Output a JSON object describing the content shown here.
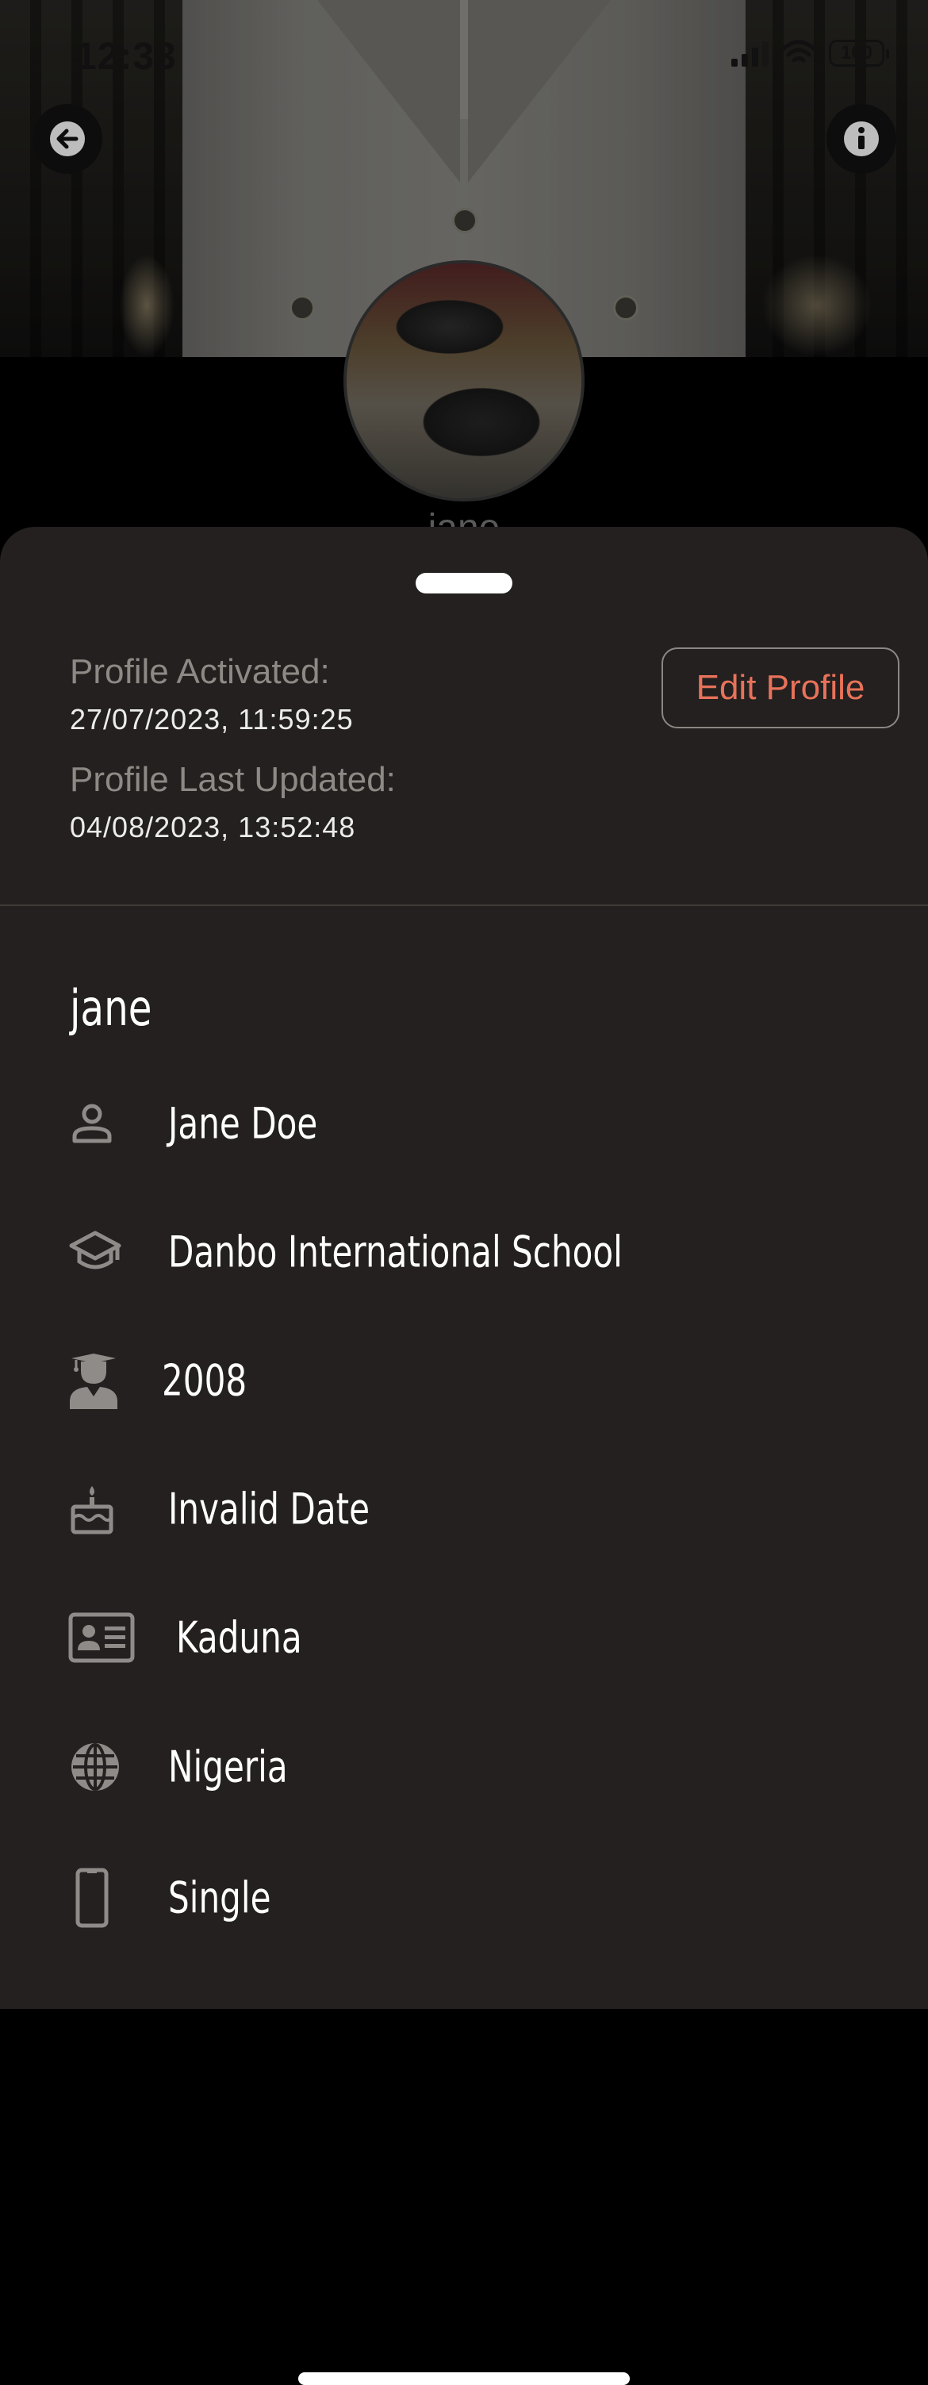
{
  "status_bar": {
    "time": "12:33",
    "battery": "100"
  },
  "header": {
    "back_icon": "arrow-left-icon",
    "info_icon": "info-icon",
    "under_avatar_name": "jane"
  },
  "sheet": {
    "profile_activated_label": "Profile Activated:",
    "profile_activated_value": "27/07/2023, 11:59:25",
    "profile_updated_label": "Profile Last Updated:",
    "profile_updated_value": "04/08/2023, 13:52:48",
    "edit_button": "Edit Profile",
    "username": "jane",
    "rows": [
      {
        "icon": "person-icon",
        "text": "Jane Doe"
      },
      {
        "icon": "school-icon",
        "text": "Danbo International School"
      },
      {
        "icon": "graduate-icon",
        "text": "2008"
      },
      {
        "icon": "cake-icon",
        "text": "Invalid Date"
      },
      {
        "icon": "id-card-icon",
        "text": "Kaduna"
      },
      {
        "icon": "globe-icon",
        "text": "Nigeria"
      },
      {
        "icon": "phone-icon",
        "text": "Single"
      }
    ]
  },
  "colors": {
    "sheet_bg": "#23201f",
    "accent": "#e8725a",
    "label_gray": "#8d8a86",
    "icon_gray": "#8e8b88"
  }
}
